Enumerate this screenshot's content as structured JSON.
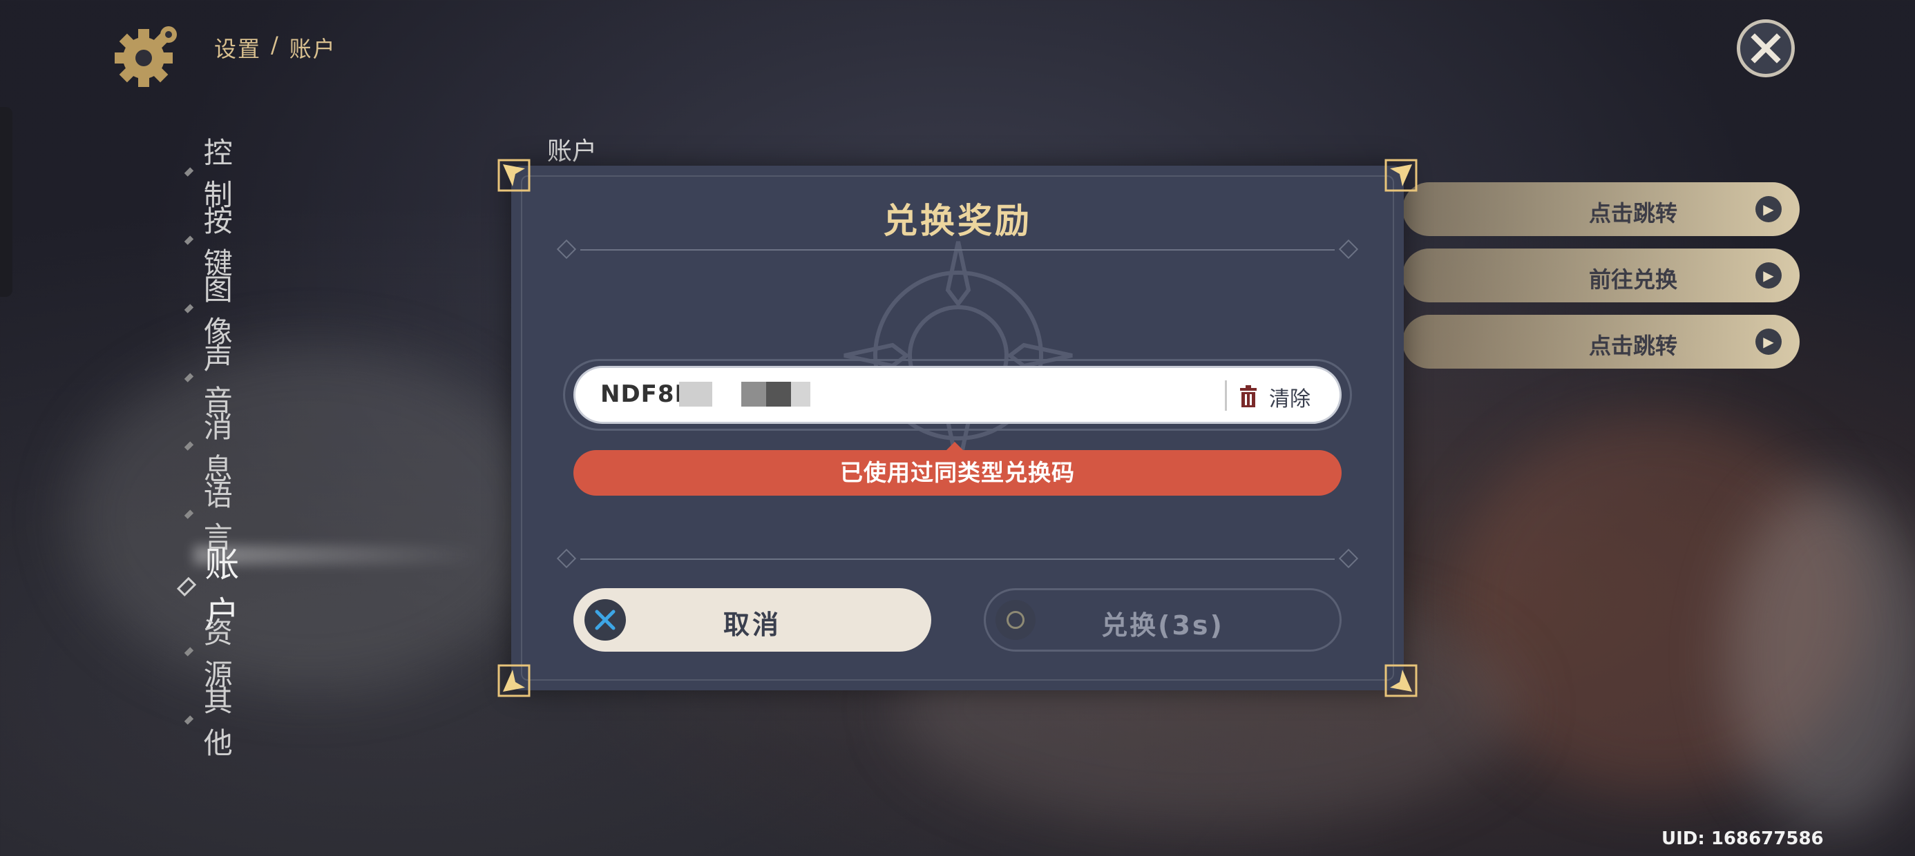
{
  "header": {
    "breadcrumb": [
      "设置",
      "/",
      "账户"
    ]
  },
  "menu": {
    "items": [
      {
        "label": "控制",
        "active": false
      },
      {
        "label": "按键",
        "active": false
      },
      {
        "label": "图像",
        "active": false
      },
      {
        "label": "声音",
        "active": false
      },
      {
        "label": "消息",
        "active": false
      },
      {
        "label": "语言",
        "active": false
      },
      {
        "label": "账户",
        "active": true
      },
      {
        "label": "资源",
        "active": false
      },
      {
        "label": "其他",
        "active": false
      }
    ]
  },
  "section": {
    "label": "账户"
  },
  "right_buttons": [
    {
      "label": "点击跳转"
    },
    {
      "label": "前往兑换"
    },
    {
      "label": "点击跳转"
    }
  ],
  "modal": {
    "title": "兑换奖励",
    "code_input": {
      "value": "NDF8M"
    },
    "clear_label": "清除",
    "error_message": "已使用过同类型兑换码",
    "cancel_label": "取消",
    "confirm_label": "兑换(3s)"
  },
  "uid": "UID: 168677586",
  "colors": {
    "accent_gold": "#ecd59e",
    "modal_bg": "#3c4257",
    "error_red": "#d45743",
    "cancel_bg": "#ece5da"
  },
  "icons": {
    "settings": "gear-icon",
    "close": "close-icon",
    "clear": "trash-icon",
    "cancel": "x-icon",
    "confirm": "circle-icon",
    "arrow": "arrow-right-icon"
  }
}
